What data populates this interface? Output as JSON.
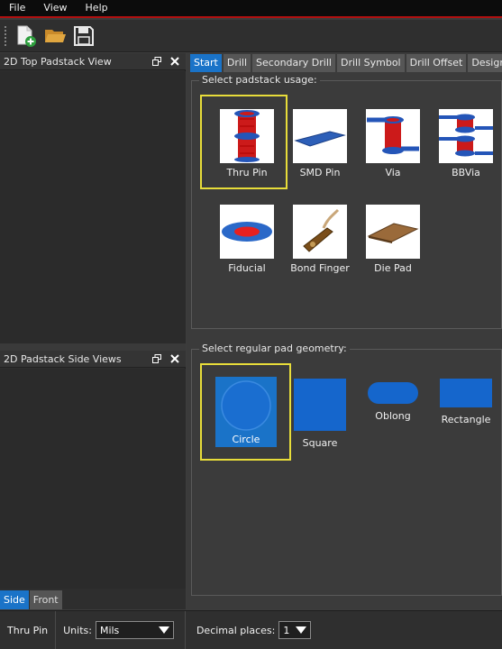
{
  "menu": [
    "File",
    "View",
    "Help"
  ],
  "toolbar": {
    "buttons": [
      "new-file-icon",
      "open-folder-icon",
      "save-icon"
    ]
  },
  "panels": {
    "top_view": {
      "title": "2D Top Padstack View"
    },
    "side_views": {
      "title": "2D Padstack Side Views"
    },
    "side_tabs": [
      "Side",
      "Front"
    ],
    "active_side_tab": "Side"
  },
  "tabs": [
    "Start",
    "Drill",
    "Secondary Drill",
    "Drill Symbol",
    "Drill Offset",
    "Design L"
  ],
  "active_tab": "Start",
  "usage": {
    "title": "Select padstack usage:",
    "options": [
      {
        "label": "Thru Pin",
        "icon": "thru-pin-icon"
      },
      {
        "label": "SMD Pin",
        "icon": "smd-pin-icon"
      },
      {
        "label": "Via",
        "icon": "via-icon"
      },
      {
        "label": "BBVia",
        "icon": "bbvia-icon"
      },
      {
        "label": "Fiducial",
        "icon": "fiducial-icon"
      },
      {
        "label": "Bond Finger",
        "icon": "bond-finger-icon"
      },
      {
        "label": "Die Pad",
        "icon": "die-pad-icon"
      }
    ],
    "selected": "Thru Pin"
  },
  "geometry": {
    "title": "Select regular pad geometry:",
    "options": [
      {
        "label": "Circle",
        "icon": "circle-shape-icon"
      },
      {
        "label": "Square",
        "icon": "square-shape-icon"
      },
      {
        "label": "Oblong",
        "icon": "oblong-shape-icon"
      },
      {
        "label": "Rectangle",
        "icon": "rectangle-shape-icon"
      }
    ],
    "selected": "Circle"
  },
  "status": {
    "current": "Thru Pin",
    "units_label": "Units:",
    "units_value": "Mils",
    "decimal_label": "Decimal places:",
    "decimal_value": "1"
  },
  "colors": {
    "accent": "#1a73c8",
    "selection": "#e8dd3a",
    "pad_blue": "#1566cc",
    "barrel_red": "#d01818",
    "menubar_line": "#b01010"
  }
}
